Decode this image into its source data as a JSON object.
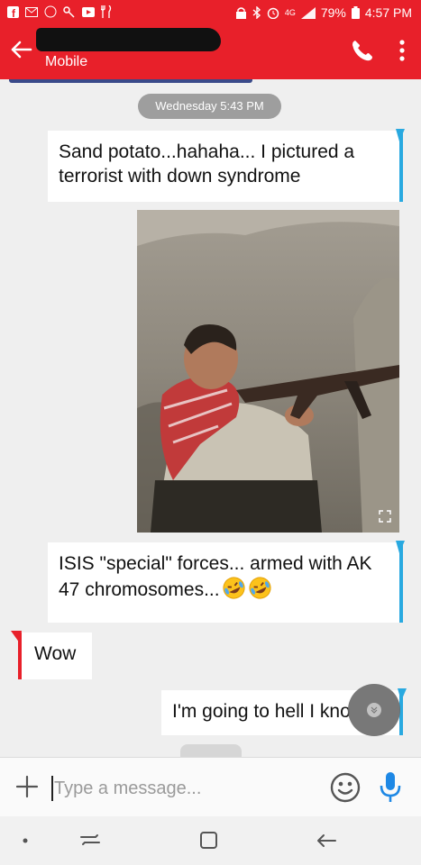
{
  "status_bar": {
    "battery": "79%",
    "time": "4:57 PM",
    "network": "4G"
  },
  "header": {
    "contact_subtitle": "Mobile",
    "icons": [
      "back-arrow-icon",
      "phone-icon",
      "more-vert-icon"
    ]
  },
  "chat": {
    "date_divider": "Wednesday 5:43 PM",
    "messages": [
      {
        "direction": "outgoing",
        "text": "Sand potato...hahaha... I pictured a terrorist with down syndrome"
      },
      {
        "direction": "outgoing",
        "type": "video",
        "expand_icon": "fullscreen-icon"
      },
      {
        "direction": "outgoing",
        "text": "ISIS \"special\" forces... armed with AK 47 chromosomes...",
        "emoji": [
          "rofl-emoji",
          "rofl-emoji"
        ]
      },
      {
        "direction": "incoming",
        "text": "Wow"
      },
      {
        "direction": "outgoing",
        "text": "I'm going to hell I kno"
      }
    ]
  },
  "compose": {
    "placeholder": "Type a message...",
    "value": ""
  },
  "colors": {
    "brand_red": "#e8202a",
    "outgoing_accent": "#29a9e0",
    "mic_blue": "#1e88e5"
  }
}
